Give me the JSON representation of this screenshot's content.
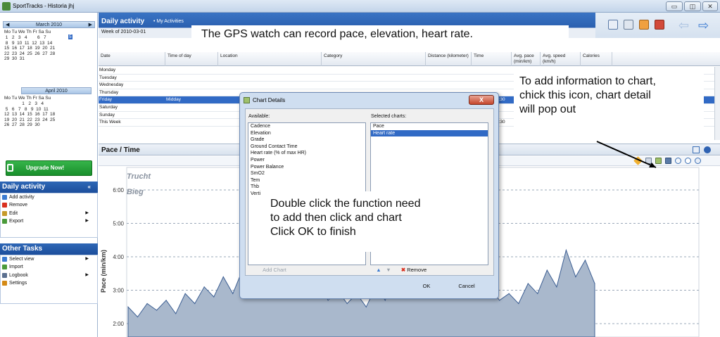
{
  "window": {
    "title": "SportTracks - Historia jhj",
    "minimize": "▭",
    "maximize": "◫",
    "close": "✕"
  },
  "calendar": {
    "march": {
      "title": "March 2010",
      "dow": "Mo Tu We Th Fr Sa Su",
      "weeks": [
        " 1   2   3   4        6   7",
        " 8   9  10  11  12  13  14",
        "15  16  17  18  19  20  21",
        "22  23  24  25  26  27  28",
        "29  30  31"
      ],
      "selected": "5"
    },
    "april": {
      "title": "April 2010",
      "dow": "Mo Tu We Th Fr Sa Su",
      "weeks": [
        "              1   2   3   4",
        " 5   6   7   8   9  10  11",
        "12  13  14  15  16  17  18",
        "19  20  21  22  23  24  25",
        "26  27  28  29  30"
      ]
    }
  },
  "upgrade": {
    "label": "Upgrade Now!"
  },
  "daily_panel": {
    "title": "Daily activity",
    "items": [
      {
        "label": "Add activity",
        "icon": "add-icon",
        "color": "#3b7bd1"
      },
      {
        "label": "Remove",
        "icon": "remove-icon",
        "color": "#d9301f"
      },
      {
        "label": "Edit",
        "icon": "edit-icon",
        "color": "#c69a2a"
      },
      {
        "label": "Export",
        "icon": "export-icon",
        "color": "#4a9a3a"
      }
    ]
  },
  "other_panel": {
    "title": "Other Tasks",
    "items": [
      {
        "label": "Select view",
        "icon": "view-icon",
        "color": "#3b7bd1"
      },
      {
        "label": "Import",
        "icon": "import-icon",
        "color": "#4a9a3a"
      },
      {
        "label": "Logbook",
        "icon": "logbook-icon",
        "color": "#5a6f8f"
      },
      {
        "label": "Settings",
        "icon": "settings-icon",
        "color": "#d48a16"
      }
    ]
  },
  "main": {
    "title": "Daily activity",
    "subtitle": "• My Activities",
    "week": "Week of 2010-03-01"
  },
  "annotations": {
    "gps": "The GPS watch can record pace, elevation, heart rate.",
    "chart_icon": [
      "To add information to chart,",
      "chick this icon, chart detail",
      "will pop out"
    ],
    "dialog": [
      "Double click the function need",
      "to add then click and chart",
      "Click OK to finish"
    ]
  },
  "grid": {
    "columns": [
      "Date",
      "Time of day",
      "Location",
      "Category",
      "Distance (kilometer)",
      "Time",
      "Avg. pace (min/km)",
      "Avg. speed (km/h)",
      "Calories"
    ],
    "rows": [
      {
        "date": "Monday",
        "time": ""
      },
      {
        "date": "Tuesday",
        "time": ""
      },
      {
        "date": "Wednesday",
        "time": ""
      },
      {
        "date": "Thursday",
        "time": ""
      },
      {
        "date": "Friday",
        "time": "Midday",
        "selected": true,
        "dur": "4:30"
      },
      {
        "date": "Saturday",
        "time": ""
      },
      {
        "date": "Sunday",
        "time": ""
      },
      {
        "date": "This Week",
        "time": "",
        "dur": "4:30"
      }
    ]
  },
  "chart_panel": {
    "title": "Pace / Time"
  },
  "chart_data": {
    "type": "area",
    "ylabel": "Pace (min/km)",
    "yticks": [
      "6:00",
      "5:00",
      "4:00",
      "3:00",
      "2:00"
    ],
    "labels": [
      "Trucht",
      "Bieg"
    ],
    "values": [
      2.5,
      2.2,
      2.6,
      2.4,
      2.7,
      2.3,
      2.9,
      2.6,
      3.1,
      2.8,
      3.4,
      2.9,
      3.6,
      3.1,
      4.1,
      3.3,
      3.9,
      3.0,
      3.6,
      2.8,
      3.2,
      2.7,
      3.0,
      2.6,
      2.9,
      2.5,
      3.1,
      2.7,
      3.4,
      2.9,
      3.8,
      3.2,
      4.0,
      3.4,
      3.7,
      3.0,
      3.3,
      2.8,
      3.1,
      2.7,
      2.9,
      2.6,
      3.2,
      2.9,
      3.6,
      3.1,
      4.2,
      3.4,
      3.9,
      3.2
    ]
  },
  "dialog": {
    "title": "Chart Details",
    "close": "X",
    "available_label": "Available:",
    "selected_label": "Selected charts:",
    "available": [
      "Cadence",
      "Elevation",
      "Grade",
      "Ground Contact Time",
      "Heart rate (% of max HR)",
      "Power",
      "Power Balance",
      "SmO2",
      "Tem",
      "Thb",
      "Verti"
    ],
    "selected": [
      "Pace",
      "Heart rate"
    ],
    "add": "Add Chart",
    "remove": "Remove",
    "ok": "OK",
    "cancel": "Cancel"
  }
}
